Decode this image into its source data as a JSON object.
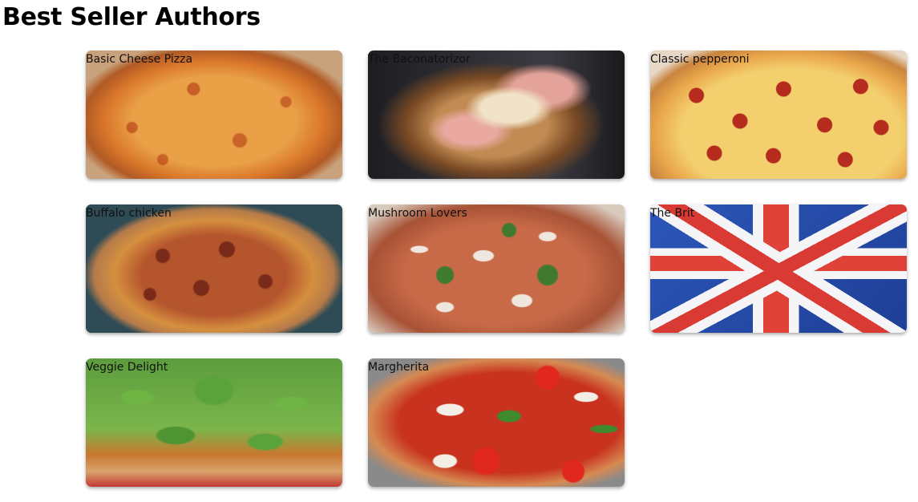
{
  "page": {
    "title": "Best Seller Authors"
  },
  "cards": [
    {
      "label": "Basic Cheese Pizza",
      "image": "cheese-pizza-image"
    },
    {
      "label": "The Baconatorizor",
      "image": "bacon-calzone-image"
    },
    {
      "label": "Classic pepperoni",
      "image": "pepperoni-pizza-image"
    },
    {
      "label": "Buffalo chicken",
      "image": "buffalo-chicken-pizza-image"
    },
    {
      "label": "Mushroom Lovers",
      "image": "mushroom-pizza-image"
    },
    {
      "label": "The Brit",
      "image": "union-jack-flag-image"
    },
    {
      "label": "Veggie Delight",
      "image": "arugula-pizza-image"
    },
    {
      "label": "Margherita",
      "image": "margherita-pizza-image"
    }
  ]
}
